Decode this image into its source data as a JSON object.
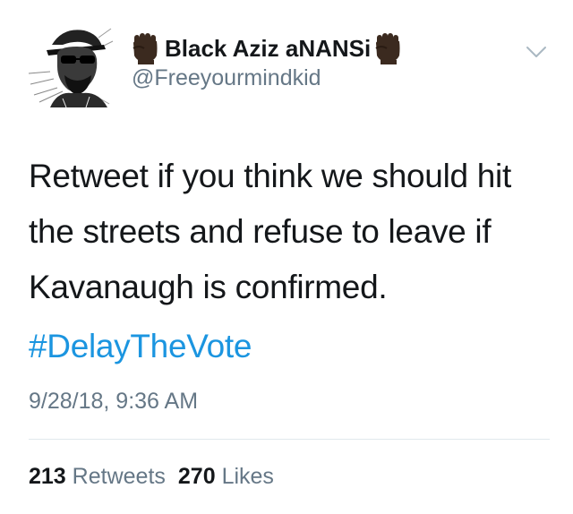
{
  "tweet": {
    "author": {
      "display_name": "Black Aziz aNANSi",
      "handle": "@Freeyourmindkid",
      "name_emoji": "raised-fist-dark-skin"
    },
    "text_lines": [
      "Retweet if you think we should hit",
      "the streets and refuse to leave if",
      "Kavanaugh is confirmed."
    ],
    "hashtag": "#DelayTheVote",
    "timestamp": "9/28/18, 9:36 AM",
    "stats": {
      "retweets_count": "213",
      "retweets_label": "Retweets",
      "likes_count": "270",
      "likes_label": "Likes"
    },
    "icons": {
      "menu": "chevron-down-icon",
      "avatar": "avatar"
    },
    "colors": {
      "text": "#14171a",
      "secondary": "#657786",
      "link": "#1b95e0",
      "divider": "#e1e8ed",
      "fist": "#3b2a1f"
    }
  }
}
